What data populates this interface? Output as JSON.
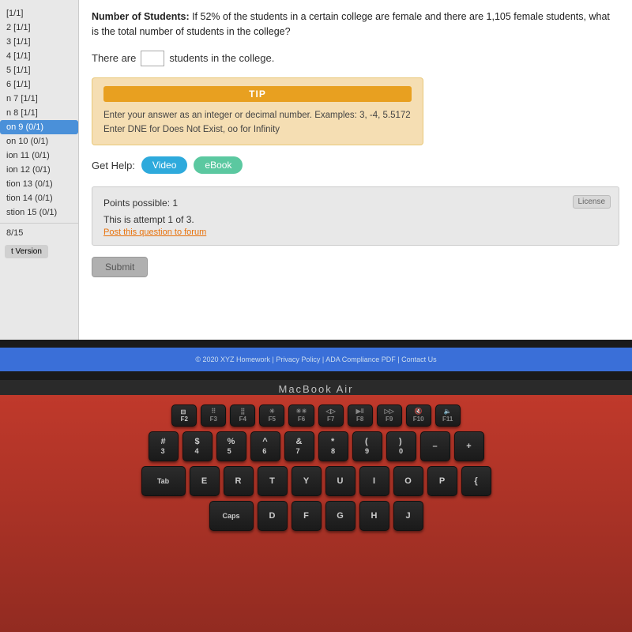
{
  "sidebar": {
    "items": [
      {
        "label": "[1/1]",
        "score": "",
        "active": false
      },
      {
        "label": "2 [1/1]",
        "score": "",
        "active": false
      },
      {
        "label": "3 [1/1]",
        "score": "",
        "active": false
      },
      {
        "label": "4 [1/1]",
        "score": "",
        "active": false
      },
      {
        "label": "5 [1/1]",
        "score": "",
        "active": false
      },
      {
        "label": "6 [1/1]",
        "score": "",
        "active": false
      },
      {
        "label": "n 7 [1/1]",
        "score": "",
        "active": false
      },
      {
        "label": "n 8 [1/1]",
        "score": "",
        "active": false
      },
      {
        "label": "on 9 (0/1)",
        "score": "",
        "active": true
      },
      {
        "label": "on 10 (0/1)",
        "score": "",
        "active": false
      },
      {
        "label": "ion 11 (0/1)",
        "score": "",
        "active": false
      },
      {
        "label": "ion 12 (0/1)",
        "score": "",
        "active": false
      },
      {
        "label": "tion 13 (0/1)",
        "score": "",
        "active": false
      },
      {
        "label": "tion 14 (0/1)",
        "score": "",
        "active": false
      },
      {
        "label": "stion 15 (0/1)",
        "score": "",
        "active": false
      }
    ],
    "footer_score": "8/15",
    "version_label": "t Version"
  },
  "question": {
    "title_bold": "Number of Students:",
    "title_text": " If 52% of the students in a certain college are female and there are 1,105 female students, what is the total number of students in the college?",
    "answer_prefix": "There are",
    "answer_suffix": "students in the college.",
    "answer_placeholder": ""
  },
  "tip": {
    "header": "TIP",
    "line1": "Enter your answer as an integer or decimal number. Examples: 3, -4, 5.5172",
    "line2": "Enter DNE for Does Not Exist, oo for Infinity"
  },
  "get_help": {
    "label": "Get Help:",
    "video_btn": "Video",
    "ebook_btn": "eBook"
  },
  "points": {
    "possible": "Points possible: 1",
    "attempt": "This is attempt 1 of 3.",
    "forum_link": "Post this question to forum",
    "license_btn": "License"
  },
  "submit": {
    "label": "Submit"
  },
  "footer": {
    "text": "© 2020 XYZ Homework | Privacy Policy | ADA Compliance PDF | Contact Us"
  },
  "macbook": {
    "label": "MacBook Air"
  },
  "keyboard": {
    "row1": [
      "F2",
      "F3/F4",
      "F5",
      "F6",
      "F7",
      "F8/F9",
      "F10",
      "F11"
    ],
    "row2": [
      "#/3",
      "$4",
      "%5",
      "^6",
      "&7",
      "*8",
      "(9",
      ")0",
      "-",
      "+/="
    ],
    "row3": [
      "E",
      "R",
      "T",
      "Y",
      "U",
      "I",
      "O",
      "P",
      "{["
    ],
    "row4": [
      "D",
      "F",
      "G",
      "H",
      "J"
    ]
  }
}
